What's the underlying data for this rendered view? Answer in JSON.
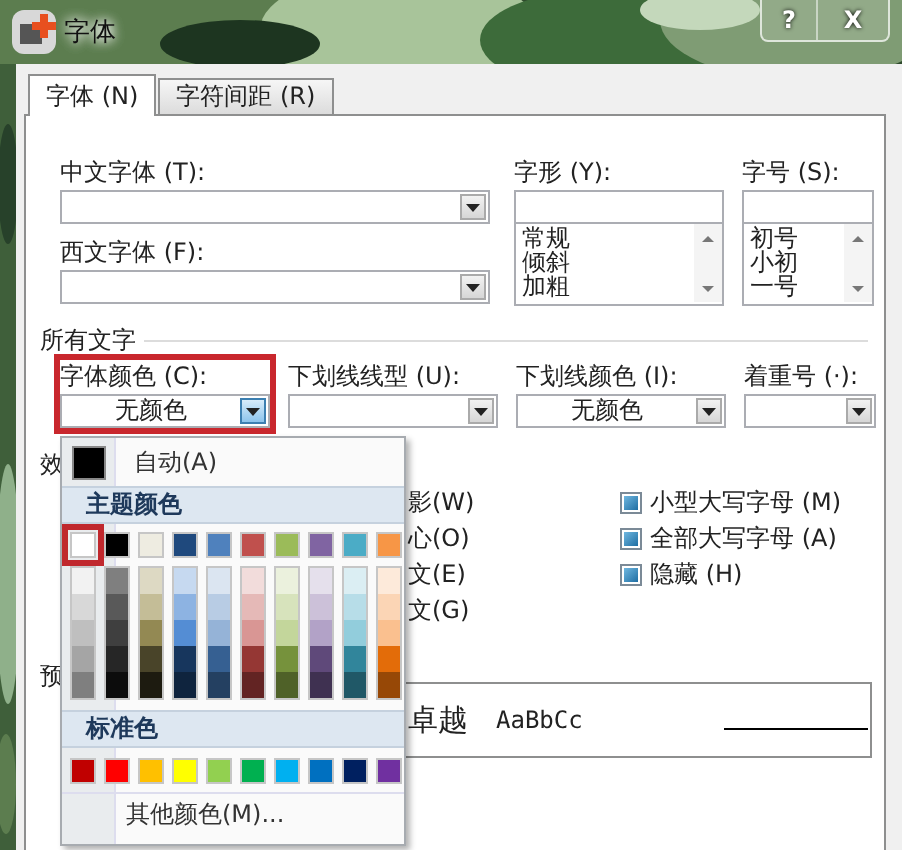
{
  "window": {
    "title": "字体",
    "buttons": [
      {
        "kind": "help",
        "label": "?"
      },
      {
        "kind": "close",
        "label": "X"
      }
    ]
  },
  "tabs": [
    {
      "label": "字体 (N)",
      "selected": true
    },
    {
      "label": "字符间距 (R)",
      "selected": false
    }
  ],
  "fonts": {
    "chinese_font": {
      "label": "中文字体 (T):"
    },
    "western_font": {
      "label": "西文字体 (F):"
    },
    "style": {
      "label": "字形 (Y):",
      "options": [
        "常规",
        "倾斜",
        "加粗"
      ]
    },
    "size": {
      "label": "字号 (S):",
      "options": [
        "初号",
        "小初",
        "一号"
      ]
    }
  },
  "all_text": {
    "heading": "所有文字",
    "fields": [
      {
        "label": "字体颜色 (C):",
        "value": "无颜色",
        "highlighted": true,
        "open": true
      },
      {
        "label": "下划线线型 (U):",
        "highlighted": false,
        "open": false
      },
      {
        "label": "下划线颜色 (I):",
        "value": "无颜色",
        "highlighted": false,
        "open": false
      },
      {
        "label": "着重号 (·):",
        "highlighted": false,
        "open": false
      }
    ]
  },
  "effects": {
    "heading": "效",
    "cut_labels": [
      "影(W)",
      "心(O)",
      "文(E)",
      "文(G)"
    ],
    "options": [
      {
        "label": "小型大写字母 (M)",
        "indeterminate": true
      },
      {
        "label": "全部大写字母 (A)",
        "indeterminate": true
      },
      {
        "label": "隐藏 (H)",
        "indeterminate": true
      }
    ]
  },
  "preview": {
    "heading": "预",
    "sample_parts": [
      "卓越",
      "AaBbCc"
    ]
  },
  "color_popup": {
    "automatic": {
      "label": "自动(A)",
      "color": "#000000"
    },
    "theme_heading": "主题颜色",
    "theme_colors": [
      {
        "color": "#ffffff",
        "selected": true,
        "shades": [
          {
            "color": "#f2f2f2"
          },
          {
            "color": "#d8d8d8"
          },
          {
            "color": "#bfbfbf"
          },
          {
            "color": "#a5a5a5"
          },
          {
            "color": "#7f7f7f"
          }
        ]
      },
      {
        "color": "#000000",
        "selected": false,
        "shades": [
          {
            "color": "#7f7f7f"
          },
          {
            "color": "#595959"
          },
          {
            "color": "#3f3f3f"
          },
          {
            "color": "#262626"
          },
          {
            "color": "#0c0c0c"
          }
        ]
      },
      {
        "color": "#eeece1",
        "selected": false,
        "shades": [
          {
            "color": "#ddd9c3"
          },
          {
            "color": "#c4bd97"
          },
          {
            "color": "#938953"
          },
          {
            "color": "#494429"
          },
          {
            "color": "#1d1b10"
          }
        ]
      },
      {
        "color": "#1f497d",
        "selected": false,
        "shades": [
          {
            "color": "#c6d9f0"
          },
          {
            "color": "#8db3e2"
          },
          {
            "color": "#548dd4"
          },
          {
            "color": "#17365d"
          },
          {
            "color": "#0f243e"
          }
        ]
      },
      {
        "color": "#4f81bd",
        "selected": false,
        "shades": [
          {
            "color": "#dbe5f1"
          },
          {
            "color": "#b8cce4"
          },
          {
            "color": "#95b3d7"
          },
          {
            "color": "#366092"
          },
          {
            "color": "#244061"
          }
        ]
      },
      {
        "color": "#c0504d",
        "selected": false,
        "shades": [
          {
            "color": "#f2dcdb"
          },
          {
            "color": "#e5b9b7"
          },
          {
            "color": "#d99694"
          },
          {
            "color": "#953734"
          },
          {
            "color": "#632423"
          }
        ]
      },
      {
        "color": "#9bbb59",
        "selected": false,
        "shades": [
          {
            "color": "#ebf1dd"
          },
          {
            "color": "#d7e3bc"
          },
          {
            "color": "#c3d69b"
          },
          {
            "color": "#76923c"
          },
          {
            "color": "#4f6128"
          }
        ]
      },
      {
        "color": "#8064a2",
        "selected": false,
        "shades": [
          {
            "color": "#e5e0ec"
          },
          {
            "color": "#ccc1d9"
          },
          {
            "color": "#b2a2c7"
          },
          {
            "color": "#5f497a"
          },
          {
            "color": "#3f3151"
          }
        ]
      },
      {
        "color": "#4bacc6",
        "selected": false,
        "shades": [
          {
            "color": "#dbeef3"
          },
          {
            "color": "#b7dde8"
          },
          {
            "color": "#92cddc"
          },
          {
            "color": "#31859b"
          },
          {
            "color": "#205867"
          }
        ]
      },
      {
        "color": "#f79646",
        "selected": false,
        "shades": [
          {
            "color": "#fdeada"
          },
          {
            "color": "#fbd5b5"
          },
          {
            "color": "#fac08f"
          },
          {
            "color": "#e36c09"
          },
          {
            "color": "#974806"
          }
        ]
      }
    ],
    "standard_heading": "标准色",
    "standard_colors": [
      {
        "color": "#c00000"
      },
      {
        "color": "#ff0000"
      },
      {
        "color": "#ffc000"
      },
      {
        "color": "#ffff00"
      },
      {
        "color": "#92d050"
      },
      {
        "color": "#00b050"
      },
      {
        "color": "#00b0f0"
      },
      {
        "color": "#0070c0"
      },
      {
        "color": "#002060"
      },
      {
        "color": "#7030a0"
      }
    ],
    "more": "其他颜色(M)..."
  }
}
